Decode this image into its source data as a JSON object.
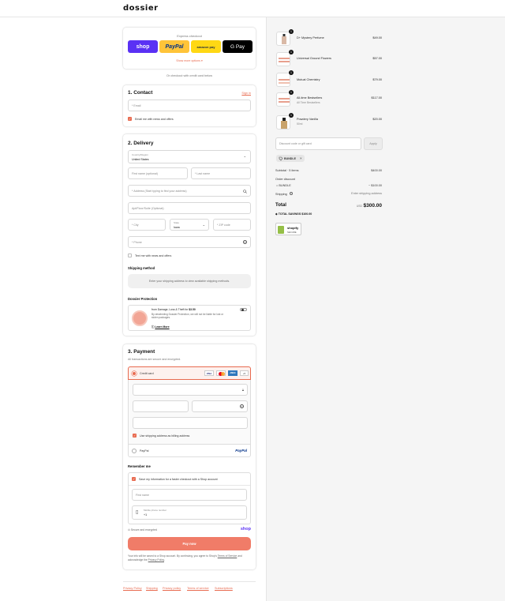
{
  "brand": {
    "logo": "dossier",
    "accent": "#e86a4f"
  },
  "express": {
    "title": "Express checkout",
    "buttons": [
      {
        "label": "shop",
        "bg": "#5a31f4",
        "fg": "#ffffff"
      },
      {
        "label": "PayPal",
        "bg": "#ffc439",
        "fg": "#003087"
      },
      {
        "label": "amazon pay",
        "bg": "#ffd814",
        "fg": "#232f3e"
      },
      {
        "label": "G Pay",
        "bg": "#000000",
        "fg": "#ffffff"
      }
    ],
    "show_more": "Show more options ▾"
  },
  "or_text": "Or checkout with credit card below",
  "contact": {
    "title": "1. Contact",
    "signin": "Sign in",
    "email_placeholder": "* Email",
    "news_label": "Email me with news and offers"
  },
  "delivery": {
    "title": "2. Delivery",
    "country_label": "Country/Region",
    "country_value": "United States",
    "first_name": "First name (optional)",
    "last_name": "* Last name",
    "address": "* Address (Start typing to find your address)",
    "apt": "Apt/Floor/Suite (Optional)",
    "city": "* City",
    "state_label": "State",
    "state_value": "Iowa",
    "zip": "* ZIP code",
    "phone": "* Phone",
    "text_label": "Text me with news and offers",
    "shipping_title": "Shipping method",
    "shipping_msg": "Enter your shipping address to view available shipping methods.",
    "protection_title": "Dossier Protection",
    "protection_head": "from Damage, Loss & Theft for ",
    "protection_price": "$3.50",
    "protection_body": "By deselecting Dossier Protection, we will not be liable for lost or stolen packages.",
    "learn_more": "Learn More"
  },
  "payment": {
    "title": "3. Payment",
    "subtitle": "All transactions are secure and encrypted.",
    "credit_card": "Credit card",
    "card_badges": [
      "VISA",
      "MC",
      "AMEX",
      "+5"
    ],
    "billing_label": "Use shipping address as billing address",
    "paypal_label": "PayPal",
    "paypal_logo": "PayPal"
  },
  "remember": {
    "title": "Remember me",
    "save_label": "Save my information for a faster checkout with a Shop account",
    "first_name": "First name",
    "phone_label": "Mobile phone number",
    "phone_prefix": "+1",
    "secure": "Secure and encrypted",
    "shop_logo": "shop",
    "pay_now": "Pay now",
    "legal_a": "Your info will be saved to a Shop account. By continuing, you agree to Shop's ",
    "terms": "Terms of Service",
    "legal_b": " and acknowledge the ",
    "privacy": "Privacy Policy",
    "legal_c": "."
  },
  "footer": [
    "Privacy Policy",
    "Shipping",
    "Privacy policy",
    "Terms of service",
    "Subscriptions"
  ],
  "cart": {
    "items": [
      {
        "qty": "1",
        "name": "D+ Mystery Perfume",
        "sub": "",
        "price": "$49.00"
      },
      {
        "qty": "1",
        "name": "Universal Ground Flowers",
        "sub": "",
        "price": "$57.00"
      },
      {
        "qty": "1",
        "name": "Mutual Chemistry",
        "sub": "",
        "price": "$79.00"
      },
      {
        "qty": "1",
        "name": "All-time Bestsellers",
        "sub": "All Time Bestsellers",
        "price": "$117.00"
      },
      {
        "qty": "1",
        "name": "Powdery Vanilla",
        "sub": "50ml",
        "price": "$20.00"
      }
    ],
    "discount_placeholder": "Discount code or gift card",
    "apply": "Apply",
    "tag": "BUNDLE",
    "subtotal_label": "Subtotal · 5 items",
    "subtotal": "$400.00",
    "order_discount": "Order discount",
    "discount_tag": "BUNDLE",
    "discount_value": "− $100.00",
    "shipping_label": "Shipping",
    "shipping_value": "Enter shipping address",
    "total_label": "Total",
    "currency": "USD",
    "total": "$300.00",
    "savings_label": "TOTAL SAVINGS",
    "savings": "$100.00",
    "badge_top": "shopify",
    "badge_bottom": "SECURE"
  }
}
